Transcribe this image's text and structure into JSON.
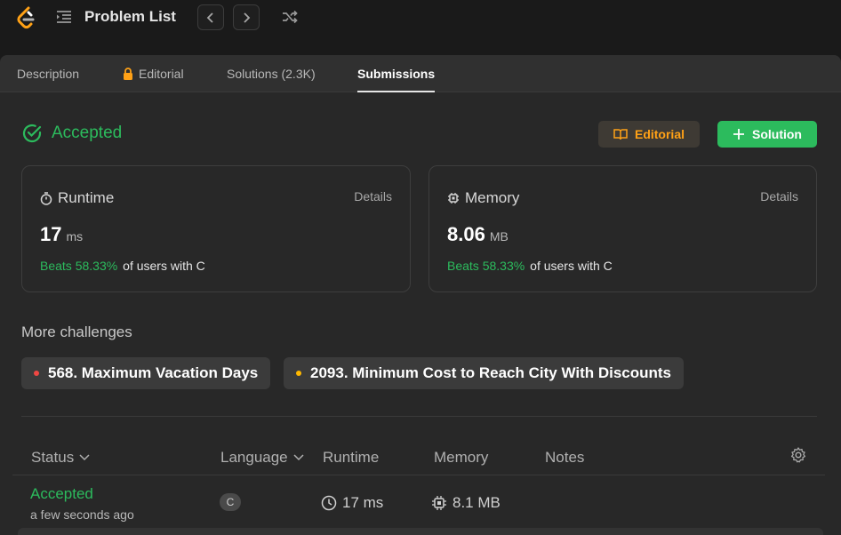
{
  "header": {
    "problem_list": "Problem List",
    "prev_icon": "chevron-left-icon",
    "next_icon": "chevron-right-icon",
    "shuffle_icon": "shuffle-icon",
    "logo_color": "#ffa116"
  },
  "tabs": [
    {
      "label": "Description"
    },
    {
      "label": "Editorial",
      "icon": "lock-icon"
    },
    {
      "label": "Solutions (2.3K)"
    },
    {
      "label": "Submissions",
      "active": true
    }
  ],
  "result": {
    "status": "Accepted",
    "editorial_button": "Editorial",
    "solution_button": "Solution"
  },
  "runtime_card": {
    "title": "Runtime",
    "details": "Details",
    "value": "17",
    "unit": "ms",
    "beats": "Beats 58.33%",
    "suffix": "of users with C"
  },
  "memory_card": {
    "title": "Memory",
    "details": "Details",
    "value": "8.06",
    "unit": "MB",
    "beats": "Beats 58.33%",
    "suffix": "of users with C"
  },
  "challenges": {
    "title": "More challenges",
    "items": [
      {
        "label": "568. Maximum Vacation Days",
        "dot_color": "#ef4743"
      },
      {
        "label": "2093. Minimum Cost to Reach City With Discounts",
        "dot_color": "#ffb800"
      }
    ]
  },
  "table": {
    "headers": {
      "status": "Status",
      "language": "Language",
      "runtime": "Runtime",
      "memory": "Memory",
      "notes": "Notes"
    },
    "rows": [
      {
        "status": "Accepted",
        "time": "a few seconds ago",
        "language": "C",
        "runtime": "17 ms",
        "memory": "8.1 MB"
      }
    ]
  },
  "colors": {
    "accent_green": "#2cbb5d",
    "accent_orange": "#ffa116",
    "panel_bg": "#282828"
  }
}
